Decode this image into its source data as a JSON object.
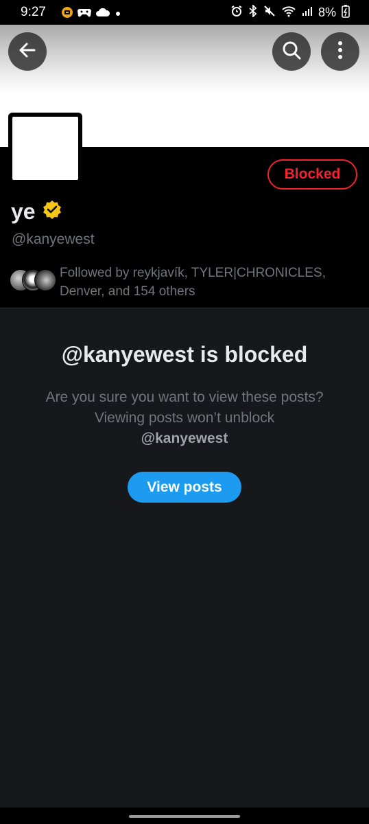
{
  "status_bar": {
    "time": "9:27",
    "battery": "8%",
    "icons": [
      "notification-badge-icon",
      "game-controller-icon",
      "cloud-icon",
      "dot-icon",
      "alarm-icon",
      "bluetooth-icon",
      "mute-icon",
      "wifi-icon",
      "signal-icon",
      "battery-charging-icon"
    ]
  },
  "header": {
    "back_icon": "arrow-left-icon",
    "search_icon": "search-icon",
    "more_icon": "more-vertical-icon"
  },
  "profile": {
    "display_name": "ye",
    "verified_icon": "verified-badge-icon",
    "verified_color": "#f5c518",
    "handle": "@kanyewest",
    "blocked_label": "Blocked",
    "blocked_color": "#f4212e",
    "followed_by": "Followed by reykjavík, TYLER|CHRONICLES, Denver, and 154 others"
  },
  "blocked_notice": {
    "title": "@kanyewest is blocked",
    "description": "Are you sure you want to view these posts? Viewing posts won’t unblock",
    "mention": "@kanyewest",
    "view_posts_label": "View posts",
    "accent_color": "#1d9bf0"
  }
}
